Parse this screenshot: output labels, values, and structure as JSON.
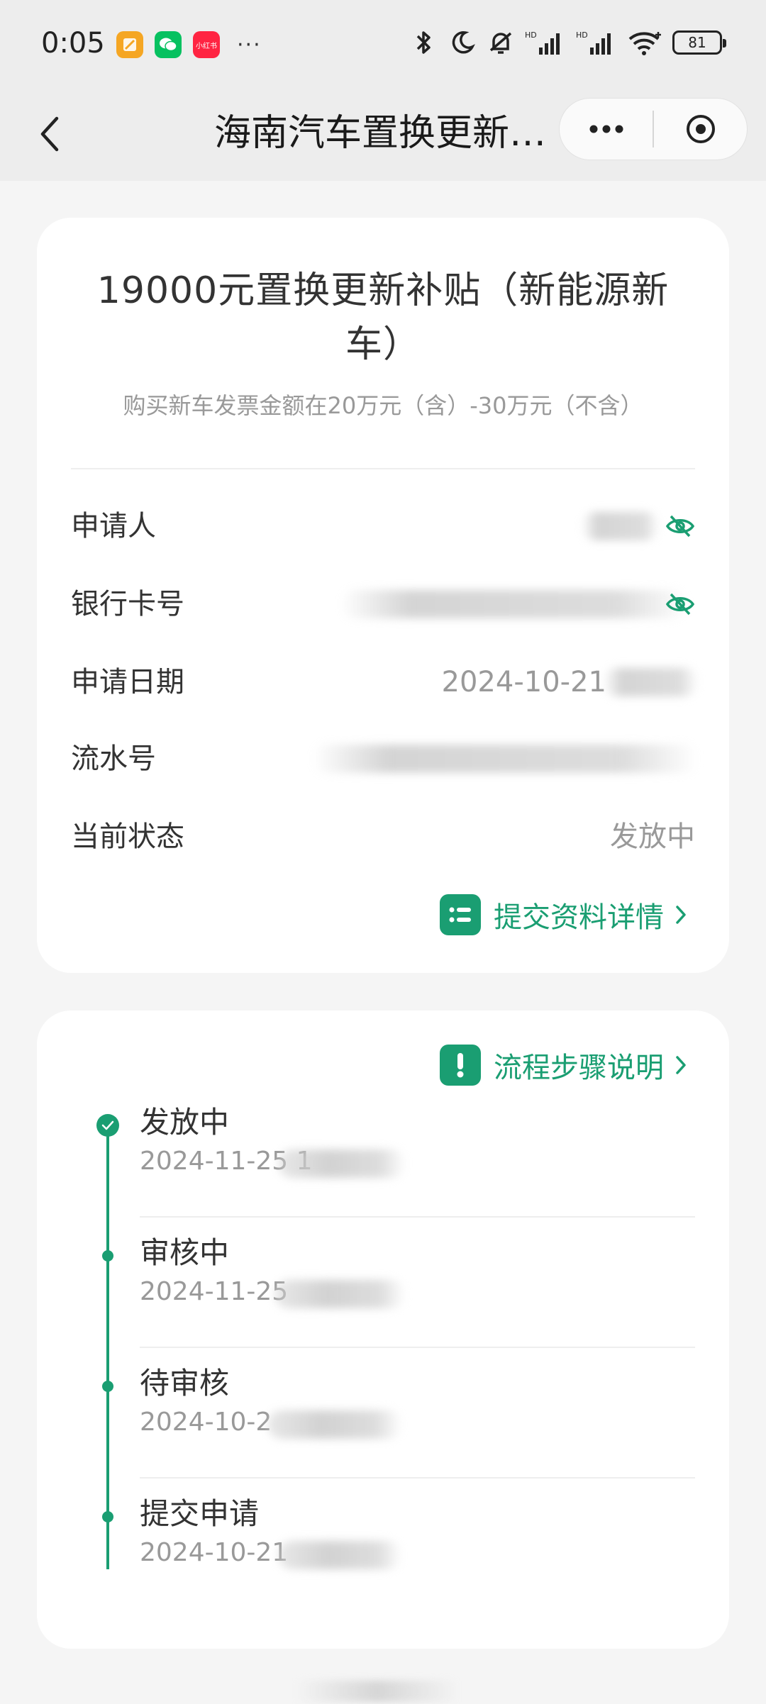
{
  "status_bar": {
    "time": "0:05",
    "more": "···",
    "battery": "81",
    "app_rednote_label": "小红书"
  },
  "nav": {
    "title": "海南汽车置换更新补贴申请"
  },
  "subsidy": {
    "title": "19000元置换更新补贴（新能源新车）",
    "subtitle": "购买新车发票金额在20万元（含）-30万元（不含）"
  },
  "info_rows": [
    {
      "label": "申请人",
      "value": ""
    },
    {
      "label": "银行卡号",
      "value": ""
    },
    {
      "label": "申请日期",
      "value": "2024-10-21"
    },
    {
      "label": "流水号",
      "value": ""
    },
    {
      "label": "当前状态",
      "value": "发放中"
    }
  ],
  "details_link": {
    "label": "提交资料详情"
  },
  "steps_link": {
    "label": "流程步骤说明"
  },
  "timeline": [
    {
      "title": "发放中",
      "date": "2024-11-25 1"
    },
    {
      "title": "审核中",
      "date": "2024-11-25"
    },
    {
      "title": "待审核",
      "date": "2024-10-2"
    },
    {
      "title": "提交申请",
      "date": "2024-10-21"
    }
  ],
  "colors": {
    "accent": "#1a9e72",
    "background": "#f5f5f5",
    "card": "#ffffff",
    "text_muted": "#999999"
  }
}
